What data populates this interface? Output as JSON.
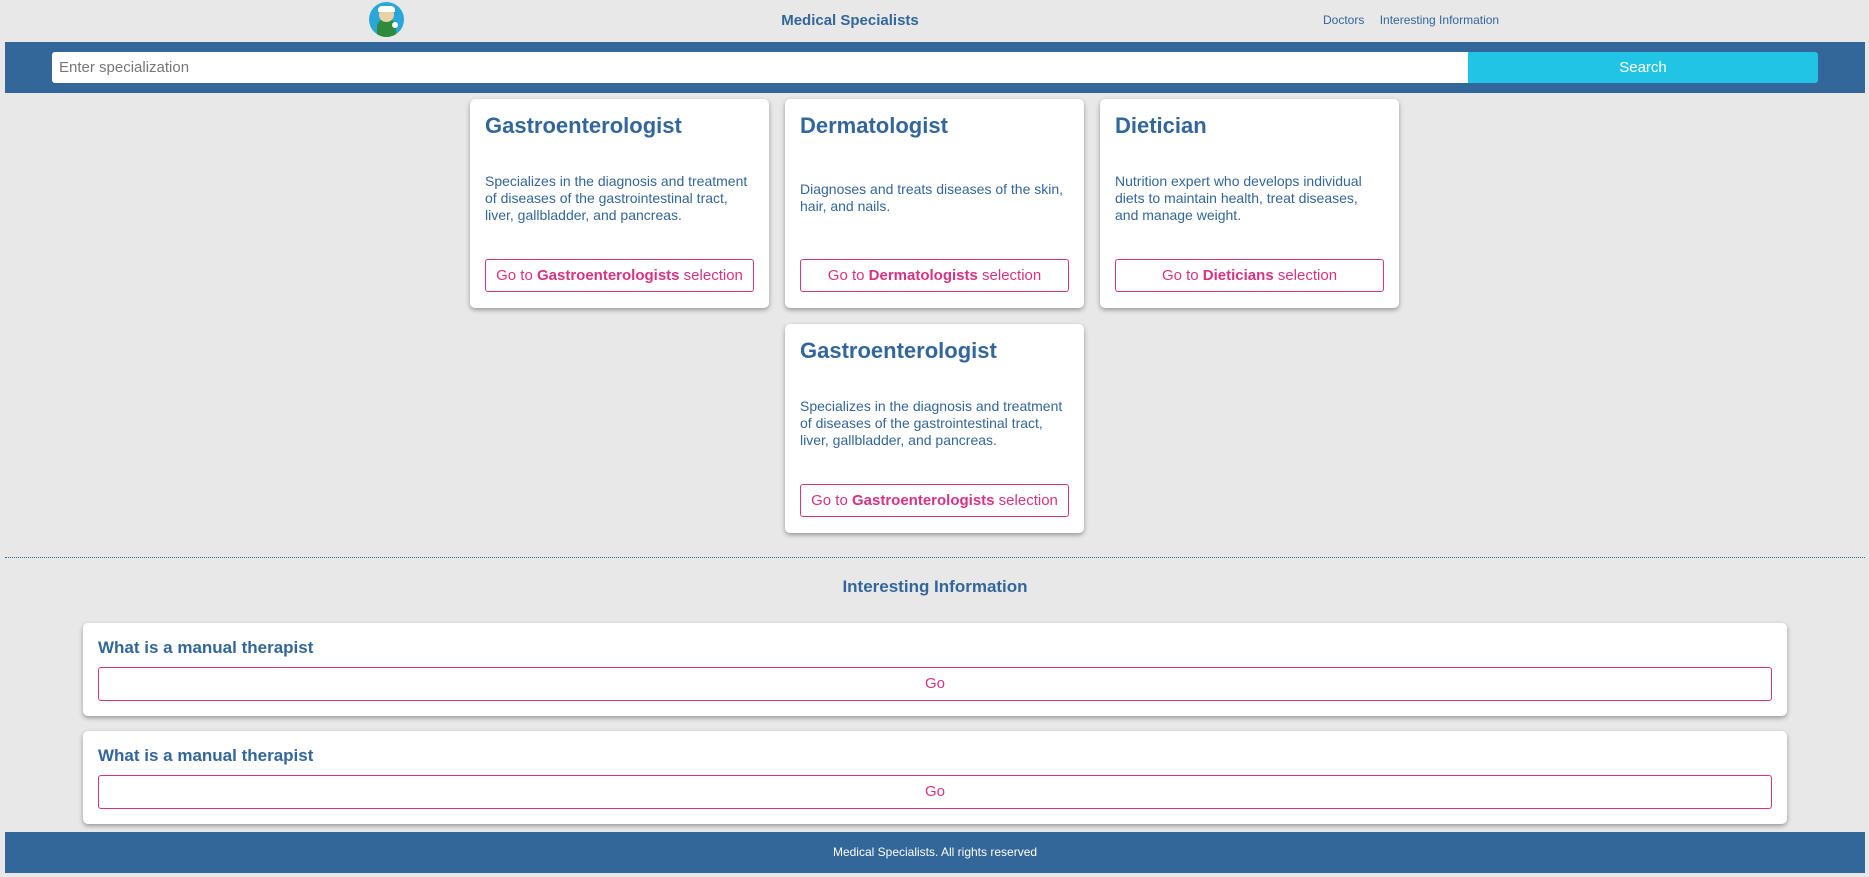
{
  "header": {
    "site_title": "Medical Specialists",
    "nav": [
      "Doctors",
      "Interesting Information"
    ]
  },
  "search": {
    "placeholder": "Enter specialization",
    "button": "Search"
  },
  "cards": [
    {
      "title": "Gastroenterologist",
      "description": "Specializes in the diagnosis and treatment of diseases of the gastrointestinal tract, liver, gallbladder, and pancreas.",
      "button_prefix": "Go to",
      "button_bold": "Gastroenterologists",
      "button_suffix": "selection"
    },
    {
      "title": "Dermatologist",
      "description": "Diagnoses and treats diseases of the skin, hair, and nails.",
      "button_prefix": "Go to",
      "button_bold": "Dermatologists",
      "button_suffix": "selection"
    },
    {
      "title": "Dietician",
      "description": "Nutrition expert who develops individual diets to maintain health, treat diseases, and manage weight.",
      "button_prefix": "Go to",
      "button_bold": "Dieticians",
      "button_suffix": "selection"
    },
    {
      "title": "Gastroenterologist",
      "description": "Specializes in the diagnosis and treatment of diseases of the gastrointestinal tract, liver, gallbladder, and pancreas.",
      "button_prefix": "Go to",
      "button_bold": "Gastroenterologists",
      "button_suffix": "selection"
    }
  ],
  "info": {
    "title": "Interesting Information",
    "items": [
      {
        "title": "What is a manual therapist",
        "button": "Go"
      },
      {
        "title": "What is a manual therapist",
        "button": "Go"
      }
    ]
  },
  "footer": {
    "text": "Medical Specialists. All rights reserved"
  },
  "colors": {
    "primary": "#336699",
    "accent": "#d63384",
    "search_button": "#22c4e6",
    "background": "#e8e8e8"
  }
}
